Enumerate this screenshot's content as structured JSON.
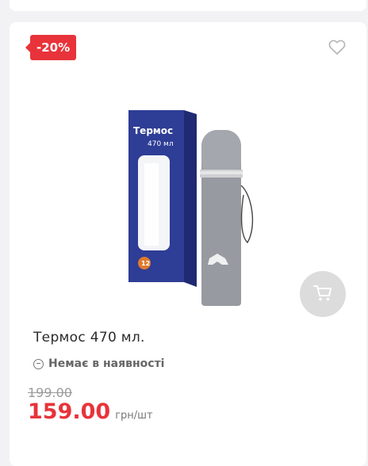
{
  "product": {
    "discount": "-20%",
    "title": "Термос 470 мл.",
    "stock_status": "Немає в наявності",
    "old_price": "199.00",
    "price": "159.00",
    "unit": "грн/шт",
    "image": {
      "box_title": "Термос",
      "box_subtitle": "470 мл",
      "colors": {
        "box": "#2e3d96",
        "flask": "#9a9da3",
        "band": "#c8c8c8"
      }
    }
  },
  "icons": {
    "favorite": "heart-outline-icon",
    "cart": "cart-icon",
    "stock": "minus-circle-icon"
  },
  "colors": {
    "accent": "#e8333a",
    "cart_button": "#dcdcdc",
    "muted": "#9a9a9a"
  }
}
